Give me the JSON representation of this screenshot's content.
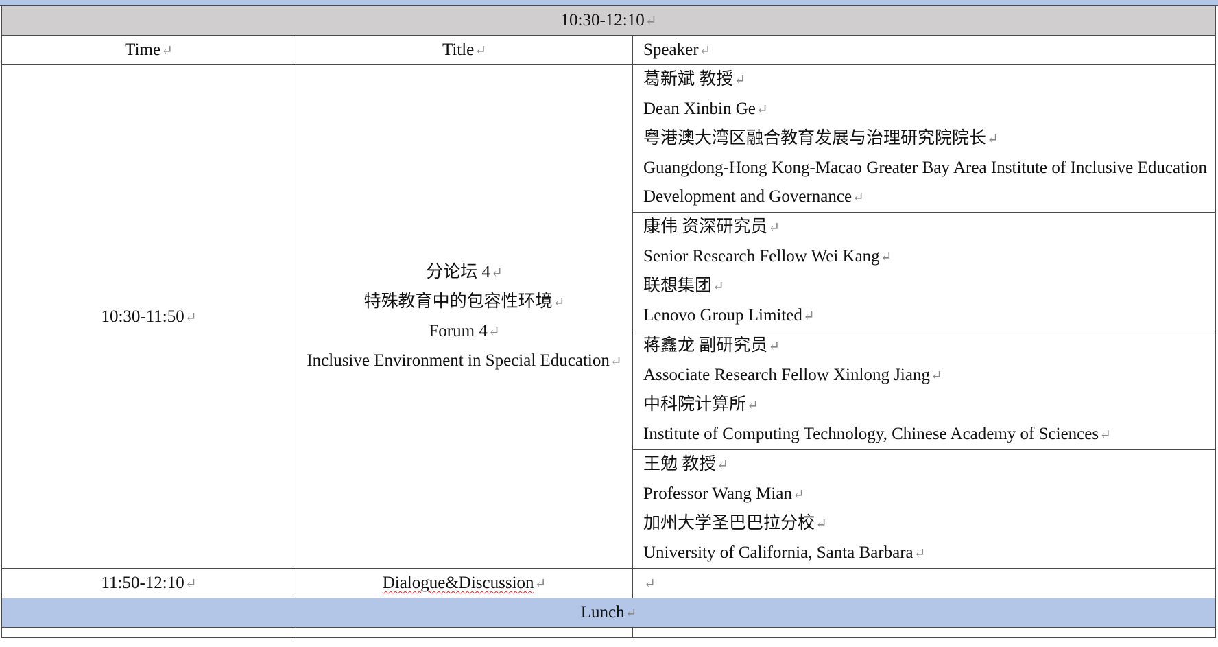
{
  "session_band": "10:30-12:10",
  "headers": {
    "time": "Time",
    "title": "Title",
    "speaker": "Speaker"
  },
  "forum": {
    "time": "10:30-11:50",
    "title_lines": [
      "分论坛 4",
      "特殊教育中的包容性环境",
      "Forum 4",
      "Inclusive Environment in Special Education"
    ],
    "speakers": [
      {
        "lines": [
          "葛新斌  教授",
          "Dean Xinbin Ge",
          "粤港澳大湾区融合教育发展与治理研究院院长",
          "Guangdong-Hong Kong-Macao Greater Bay Area Institute of Inclusive Education Development and Governance"
        ]
      },
      {
        "lines": [
          "康伟  资深研究员",
          "Senior Research Fellow Wei Kang",
          "联想集团",
          "Lenovo Group Limited"
        ]
      },
      {
        "lines": [
          "蒋鑫龙  副研究员",
          "Associate Research Fellow Xinlong Jiang",
          "中科院计算所",
          "Institute of Computing Technology, Chinese Academy of Sciences"
        ]
      },
      {
        "lines": [
          "王勉  教授",
          "Professor Wang Mian",
          "加州大学圣巴巴拉分校",
          "University of California, Santa Barbara"
        ]
      }
    ]
  },
  "dialogue": {
    "time": "11:50-12:10",
    "title": "Dialogue&Discussion",
    "speaker": ""
  },
  "lunch_band": "Lunch",
  "colors": {
    "gray_band": "#d0cece",
    "blue_band": "#b4c6e7",
    "border": "#4a4a4a",
    "spell_underline": "#d03030"
  }
}
